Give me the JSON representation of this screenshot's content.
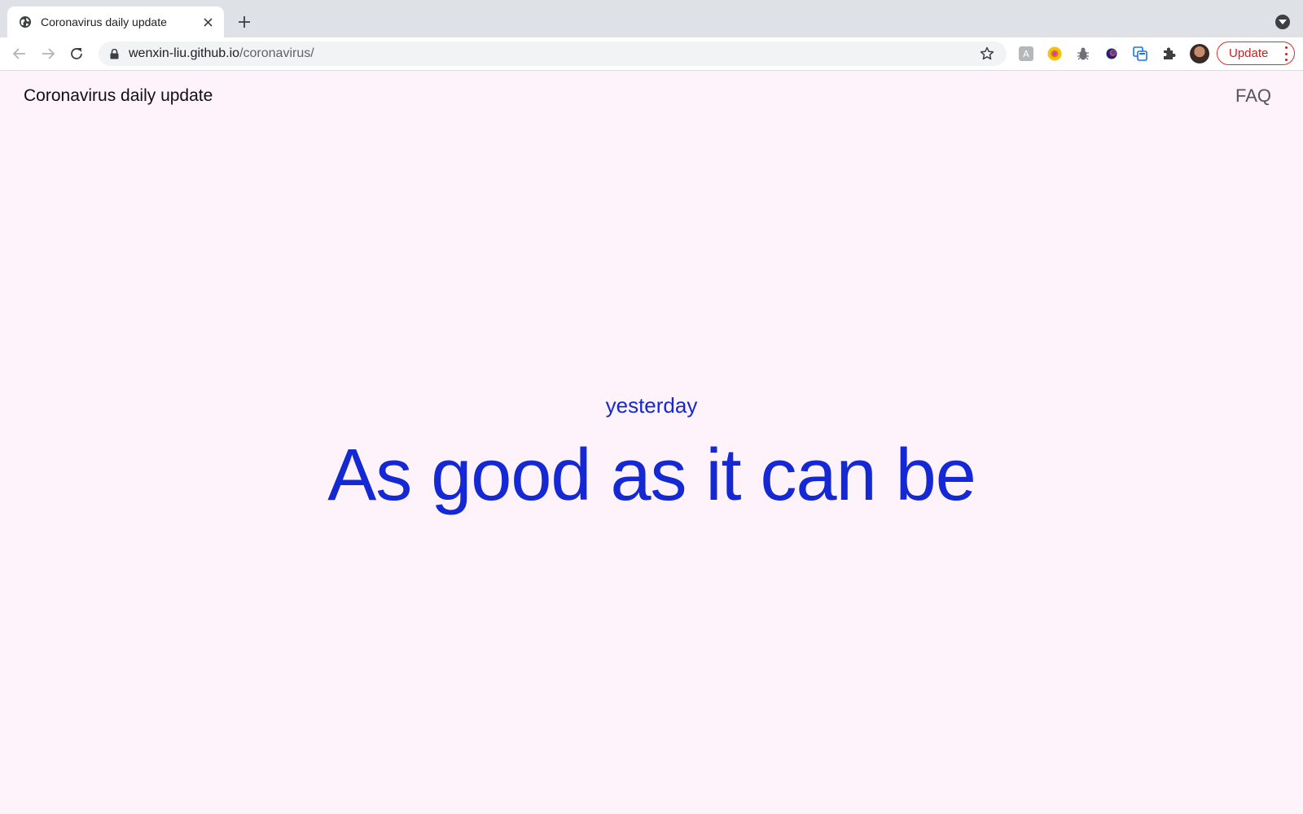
{
  "browser": {
    "tab": {
      "title": "Coronavirus daily update",
      "favicon": "globe-icon",
      "close_icon": "close-icon"
    },
    "new_tab_icon": "plus-icon",
    "address_bar": {
      "host": "wenxin-liu.github.io",
      "path": "/coronavirus/"
    },
    "update_button_label": "Update",
    "accent_update": "#d93025"
  },
  "page": {
    "background": "#fef2fb",
    "accent": "#1428d4",
    "site_title": "Coronavirus daily update",
    "nav_faq": "FAQ",
    "day_label": "yesterday",
    "status_headline": "As good as it can be"
  }
}
